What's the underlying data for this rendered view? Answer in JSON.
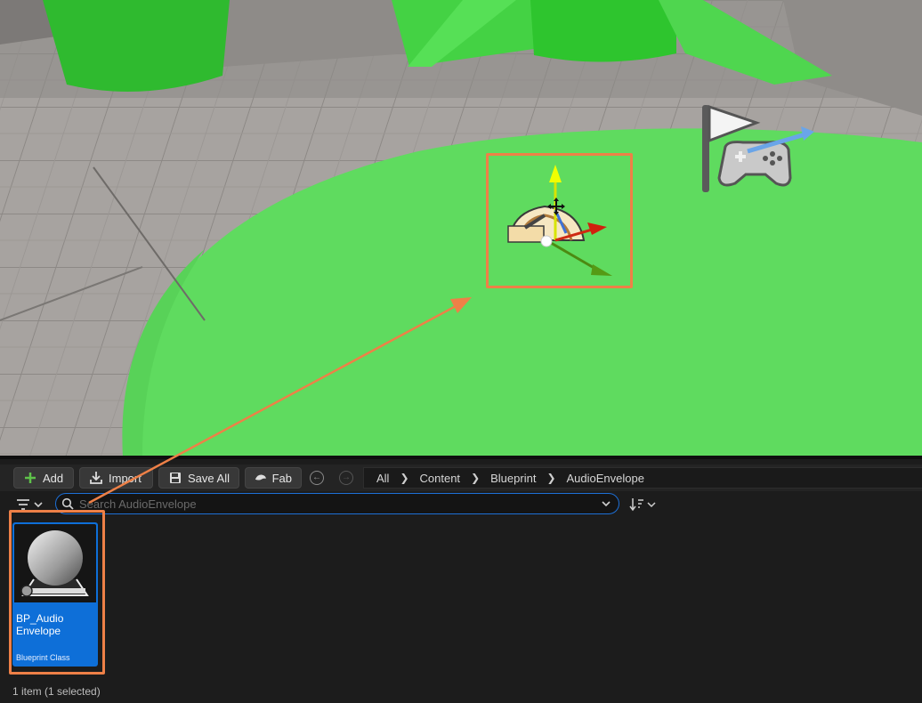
{
  "toolbar": {
    "add_label": "Add",
    "import_label": "Import",
    "save_all_label": "Save All",
    "fab_label": "Fab"
  },
  "breadcrumb": [
    "All",
    "Content",
    "Blueprint",
    "AudioEnvelope"
  ],
  "search": {
    "placeholder": "Search AudioEnvelope",
    "value": ""
  },
  "assets": [
    {
      "name_line1": "BP_Audio",
      "name_line2": "Envelope",
      "type": "Blueprint Class",
      "selected": true
    }
  ],
  "status": "1 item (1 selected)",
  "colors": {
    "accent": "#0e6fd8",
    "annotation": "#ee8047",
    "floor_green": "#5fdb5f"
  },
  "icons": [
    "add-icon",
    "import-icon",
    "save-icon",
    "fab-icon",
    "back-icon",
    "forward-icon",
    "filter-icon",
    "search-icon",
    "sort-icon",
    "player-start-icon",
    "audio-component-icon",
    "move-gizmo-icon"
  ]
}
